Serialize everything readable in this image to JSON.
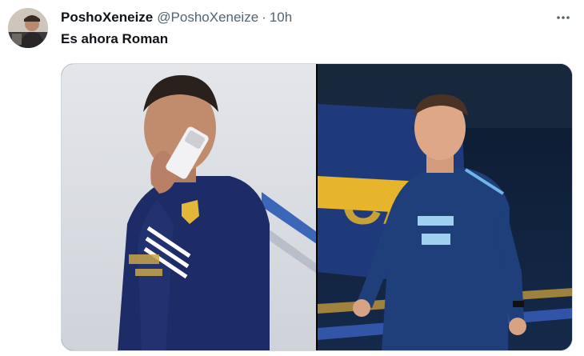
{
  "tweet": {
    "display_name": "PoshoXeneize",
    "handle": "@PoshoXeneize",
    "separator": "·",
    "time": "10h",
    "text": "Es ahora Roman"
  },
  "icons": {
    "avatar": "profile-avatar",
    "more": "more-options-icon"
  },
  "media": {
    "images": [
      {
        "name": "photo-man-on-phone-navy-training-top"
      },
      {
        "name": "photo-coach-navy-shirt-stadium"
      }
    ]
  },
  "colors": {
    "text": "#0f1419",
    "secondary": "#536471",
    "border": "#cfd9de"
  }
}
